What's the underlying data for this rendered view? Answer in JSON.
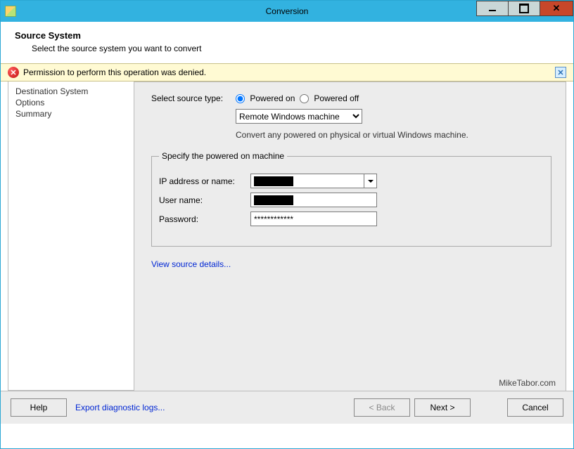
{
  "window": {
    "title": "Conversion"
  },
  "header": {
    "title": "Source System",
    "subtitle": "Select the source system you want to convert"
  },
  "warning": {
    "message": "Permission to perform this operation was denied."
  },
  "sidebar": {
    "items": [
      "Destination System",
      "Options",
      "Summary"
    ]
  },
  "main": {
    "source_type_label": "Select source type:",
    "radio_on": "Powered on",
    "radio_off": "Powered off",
    "machine_type_selected": "Remote Windows machine",
    "hint": "Convert any powered on physical or virtual Windows machine.",
    "group_legend": "Specify the powered on machine",
    "ip_label": "IP address or name:",
    "user_label": "User name:",
    "pass_label": "Password:",
    "pass_value": "************",
    "view_details": "View source details..."
  },
  "watermark": "MikeTabor.com",
  "footer": {
    "help": "Help",
    "export": "Export diagnostic logs...",
    "back": "< Back",
    "next": "Next >",
    "cancel": "Cancel"
  }
}
